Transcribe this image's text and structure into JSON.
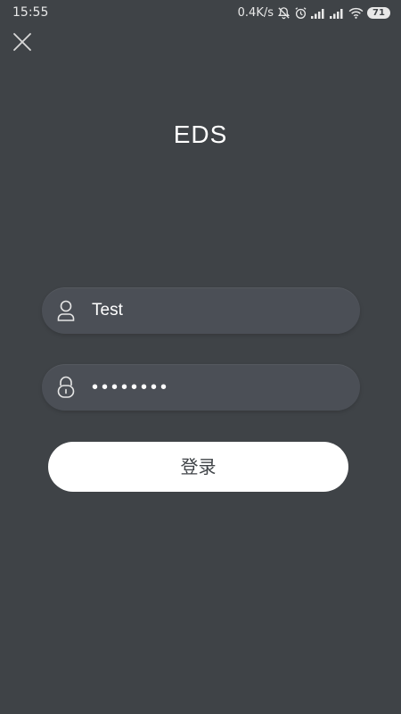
{
  "status_bar": {
    "time": "15:55",
    "network_speed": "0.4K/s",
    "battery": "71",
    "icons": [
      "mute-icon",
      "alarm-icon",
      "signal-icon",
      "signal-icon",
      "wifi-icon",
      "battery-icon"
    ]
  },
  "header": {
    "close_icon": "close-icon"
  },
  "app": {
    "title": "EDS"
  },
  "login_form": {
    "username": {
      "icon": "user-icon",
      "value": "Test"
    },
    "password": {
      "icon": "lock-icon",
      "value": "••••••••"
    },
    "submit_label": "登录"
  },
  "colors": {
    "background": "#3f4347",
    "field": "#4b4f56",
    "button": "#ffffff",
    "button_text": "#3f4347"
  }
}
